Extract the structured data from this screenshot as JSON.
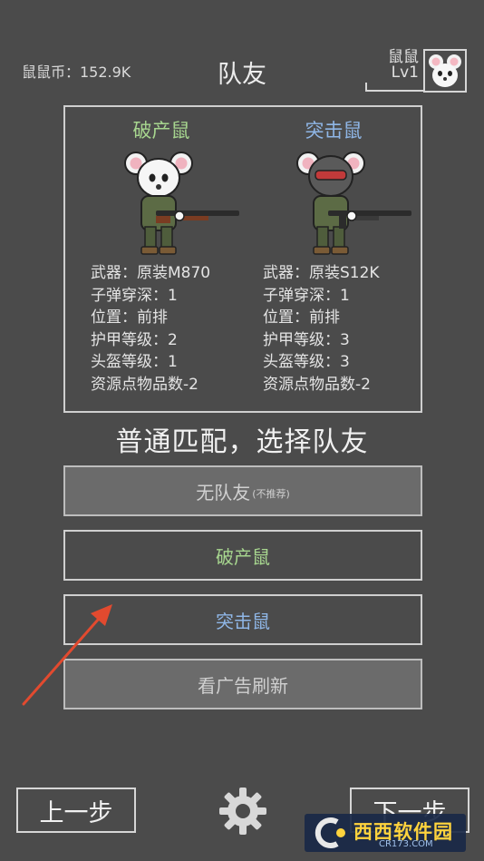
{
  "header": {
    "currency_label": "鼠鼠币：152.9K",
    "title": "队友",
    "player_name": "鼠鼠",
    "player_level": "Lv1"
  },
  "teammates": [
    {
      "name": "破产鼠",
      "stats": [
        "武器：原装M870",
        "子弹穿深：1",
        "位置：前排",
        "护甲等级：2",
        "头盔等级：1",
        "资源点物品数-2"
      ]
    },
    {
      "name": "突击鼠",
      "stats": [
        "武器：原装S12K",
        "子弹穿深：1",
        "位置：前排",
        "护甲等级：3",
        "头盔等级：3",
        "资源点物品数-2"
      ]
    }
  ],
  "prompt": "普通匹配，选择队友",
  "options": {
    "no_teammate": "无队友",
    "no_teammate_note": "(不推荐)",
    "bankrupt_mouse": "破产鼠",
    "assault_mouse": "突击鼠",
    "refresh_ad": "看广告刷新"
  },
  "nav": {
    "prev": "上一步",
    "next": "下一步"
  },
  "watermark": {
    "main": "西西软件园",
    "sub": "CR173.COM"
  },
  "colors": {
    "background": "#4b4b4b",
    "green_name": "#a7d68f",
    "blue_name": "#8fb6e6",
    "arrow": "#e24a2f"
  },
  "icons": [
    "mouse-avatar-icon",
    "gear-icon",
    "shotgun-icon",
    "arrow-icon"
  ]
}
